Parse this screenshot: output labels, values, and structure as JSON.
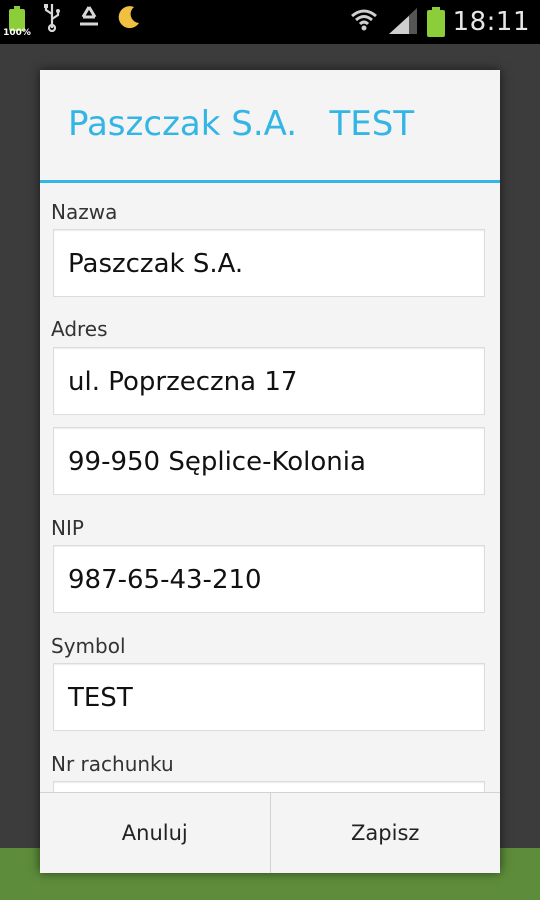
{
  "status_bar": {
    "battery_small_percent": "100%",
    "time": "18:11",
    "icons": [
      "battery-icon",
      "usb-icon",
      "recycle-icon",
      "moon-icon",
      "wifi-icon",
      "signal-icon",
      "battery-icon"
    ]
  },
  "dialog": {
    "title": "Paszczak S.A.   TEST",
    "fields": {
      "nazwa_label": "Nazwa",
      "nazwa_value": "Paszczak S.A.",
      "adres_label": "Adres",
      "adres_line1": "ul. Poprzeczna 17",
      "adres_line2": "99-950 Sęplice-Kolonia",
      "nip_label": "NIP",
      "nip_value": "987-65-43-210",
      "symbol_label": "Symbol",
      "symbol_value": "TEST",
      "rachunek_label": "Nr rachunku"
    },
    "buttons": {
      "cancel": "Anuluj",
      "save": "Zapisz"
    }
  },
  "colors": {
    "accent": "#33b5e5",
    "battery": "#8ccd3a"
  }
}
